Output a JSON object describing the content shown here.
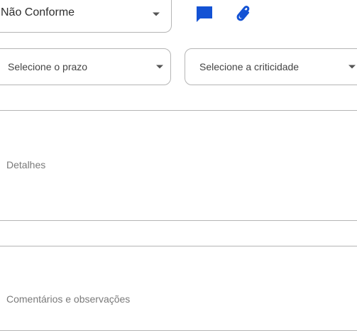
{
  "status_select": {
    "value": "Não Conforme"
  },
  "toolbar": {
    "comment_icon": "comment-icon",
    "attach_icon": "paperclip-icon",
    "icon_color": "#1352d4"
  },
  "deadline_select": {
    "placeholder": "Selecione o prazo"
  },
  "criticality_select": {
    "placeholder": "Selecione a criticidade"
  },
  "details": {
    "placeholder": "Detalhes"
  },
  "comments": {
    "placeholder": "Comentários e observações"
  }
}
